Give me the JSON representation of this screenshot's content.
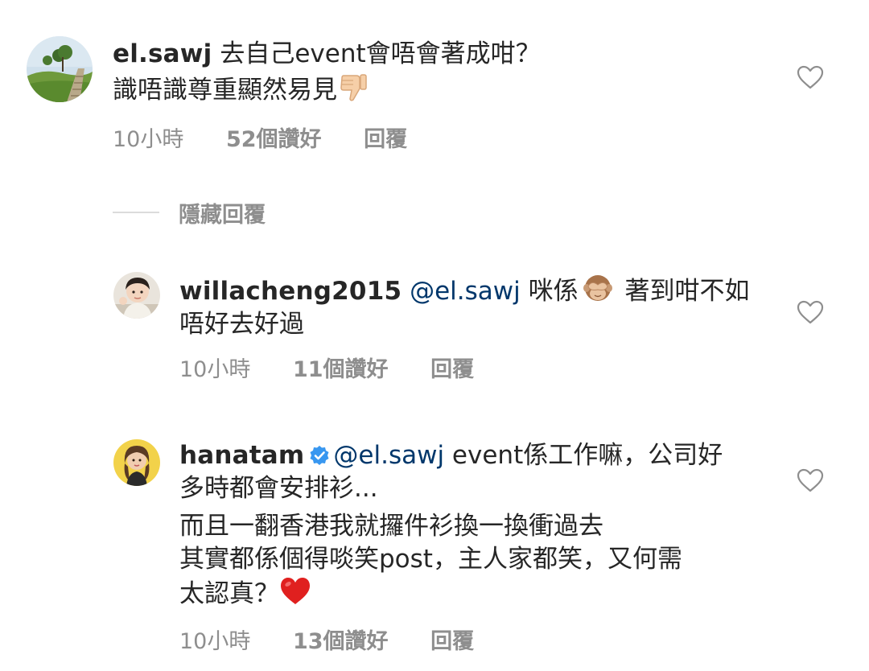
{
  "comments": [
    {
      "username": "el.sawj",
      "text_line1": " 去自己event會唔會著成咁？",
      "text_line2": "識唔識尊重顯然易見",
      "emoji": "thumbs-down",
      "time": "10小時",
      "likes": "52個讚好",
      "reply": "回覆"
    },
    {
      "username": "willacheng2015",
      "mention": "@el.sawj",
      "text_line1": " 咪係",
      "emoji": "see-no-evil-monkey",
      "text_line1_after": " 著到咁不如",
      "text_line2": "唔好去好過",
      "time": "10小時",
      "likes": "11個讚好",
      "reply": "回覆"
    },
    {
      "username": "hanatam",
      "verified": true,
      "mention": "@el.sawj",
      "text_line1": " event係工作嘛，公司好",
      "text_line2": "多時都會安排衫...",
      "text_line3": "而且一翻香港我就攞件衫換一換衝過去",
      "text_line4": "其實都係個得啖笑post，主人家都笑，又何需",
      "text_line5": "太認真？",
      "emoji": "red-heart",
      "time": "10小時",
      "likes": "13個讚好",
      "reply": "回覆"
    }
  ],
  "hide_replies": "隱藏回覆",
  "colors": {
    "text": "#262626",
    "secondary": "#8e8e8e",
    "mention": "#00376b",
    "verified": "#3897f0",
    "divider": "#dbdbdb"
  },
  "icons": {
    "like": "heart-outline-icon",
    "verified": "verified-badge-icon"
  }
}
